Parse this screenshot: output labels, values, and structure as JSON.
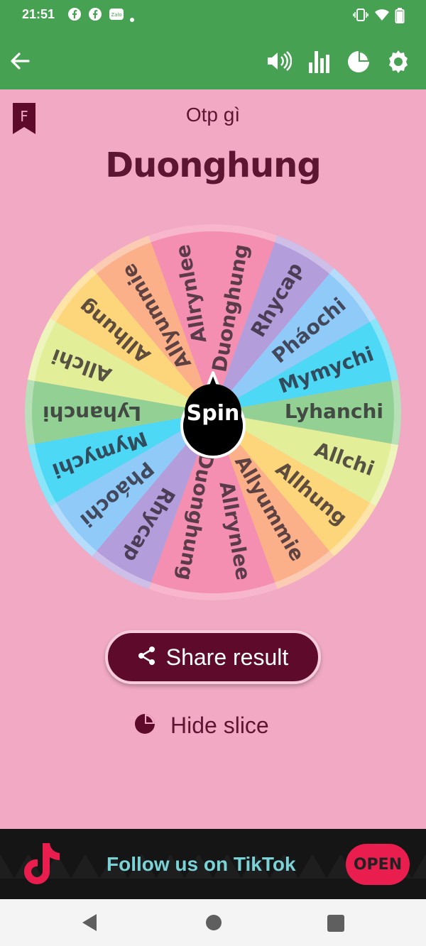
{
  "status_bar": {
    "time": "21:51",
    "icons": [
      "facebook-icon",
      "facebook-icon",
      "zalo-icon",
      "dot-icon",
      "vibrate-icon",
      "wifi-icon",
      "battery-icon"
    ],
    "zalo_label": "Zalo"
  },
  "app_bar": {
    "color": "#47a152",
    "icons": [
      "back-arrow-icon",
      "volume-icon",
      "bar-chart-icon",
      "pie-chart-icon",
      "settings-gear-icon"
    ]
  },
  "main": {
    "bookmark_letter": "F",
    "subtitle": "Otp gì",
    "result": "Duonghung",
    "spin_label": "Spin"
  },
  "wheel": {
    "slices": [
      {
        "label": "Duonghung",
        "color": "#f48fb1"
      },
      {
        "label": "Rhycap",
        "color": "#b39ddb"
      },
      {
        "label": "Pháochi",
        "color": "#90caf9"
      },
      {
        "label": "Mymychi",
        "color": "#4dd8f5"
      },
      {
        "label": "Lyhanchi",
        "color": "#93d093"
      },
      {
        "label": "Allchi",
        "color": "#e3ee98"
      },
      {
        "label": "Allhung",
        "color": "#fdd67c"
      },
      {
        "label": "Allyummie",
        "color": "#fbb08a"
      },
      {
        "label": "Allrynlee",
        "color": "#f48fb1"
      },
      {
        "label": "Duonghung",
        "color": "#f48fb1"
      },
      {
        "label": "Rhycap",
        "color": "#b39ddb"
      },
      {
        "label": "Pháochi",
        "color": "#90caf9"
      },
      {
        "label": "Mymychi",
        "color": "#4dd8f5"
      },
      {
        "label": "Lyhanchi",
        "color": "#93d093"
      },
      {
        "label": "Allchi",
        "color": "#e3ee98"
      },
      {
        "label": "Allhung",
        "color": "#fdd67c"
      },
      {
        "label": "Allyummie",
        "color": "#fbb08a"
      },
      {
        "label": "Allrynlee",
        "color": "#f48fb1"
      }
    ]
  },
  "actions": {
    "share_label": "Share result",
    "hide_label": "Hide slice"
  },
  "ad": {
    "text": "Follow us on TikTok",
    "button": "OPEN"
  },
  "colors": {
    "primary_dark": "#5e0a2a",
    "background": "#f1a9c4",
    "accent": "#47a152"
  }
}
